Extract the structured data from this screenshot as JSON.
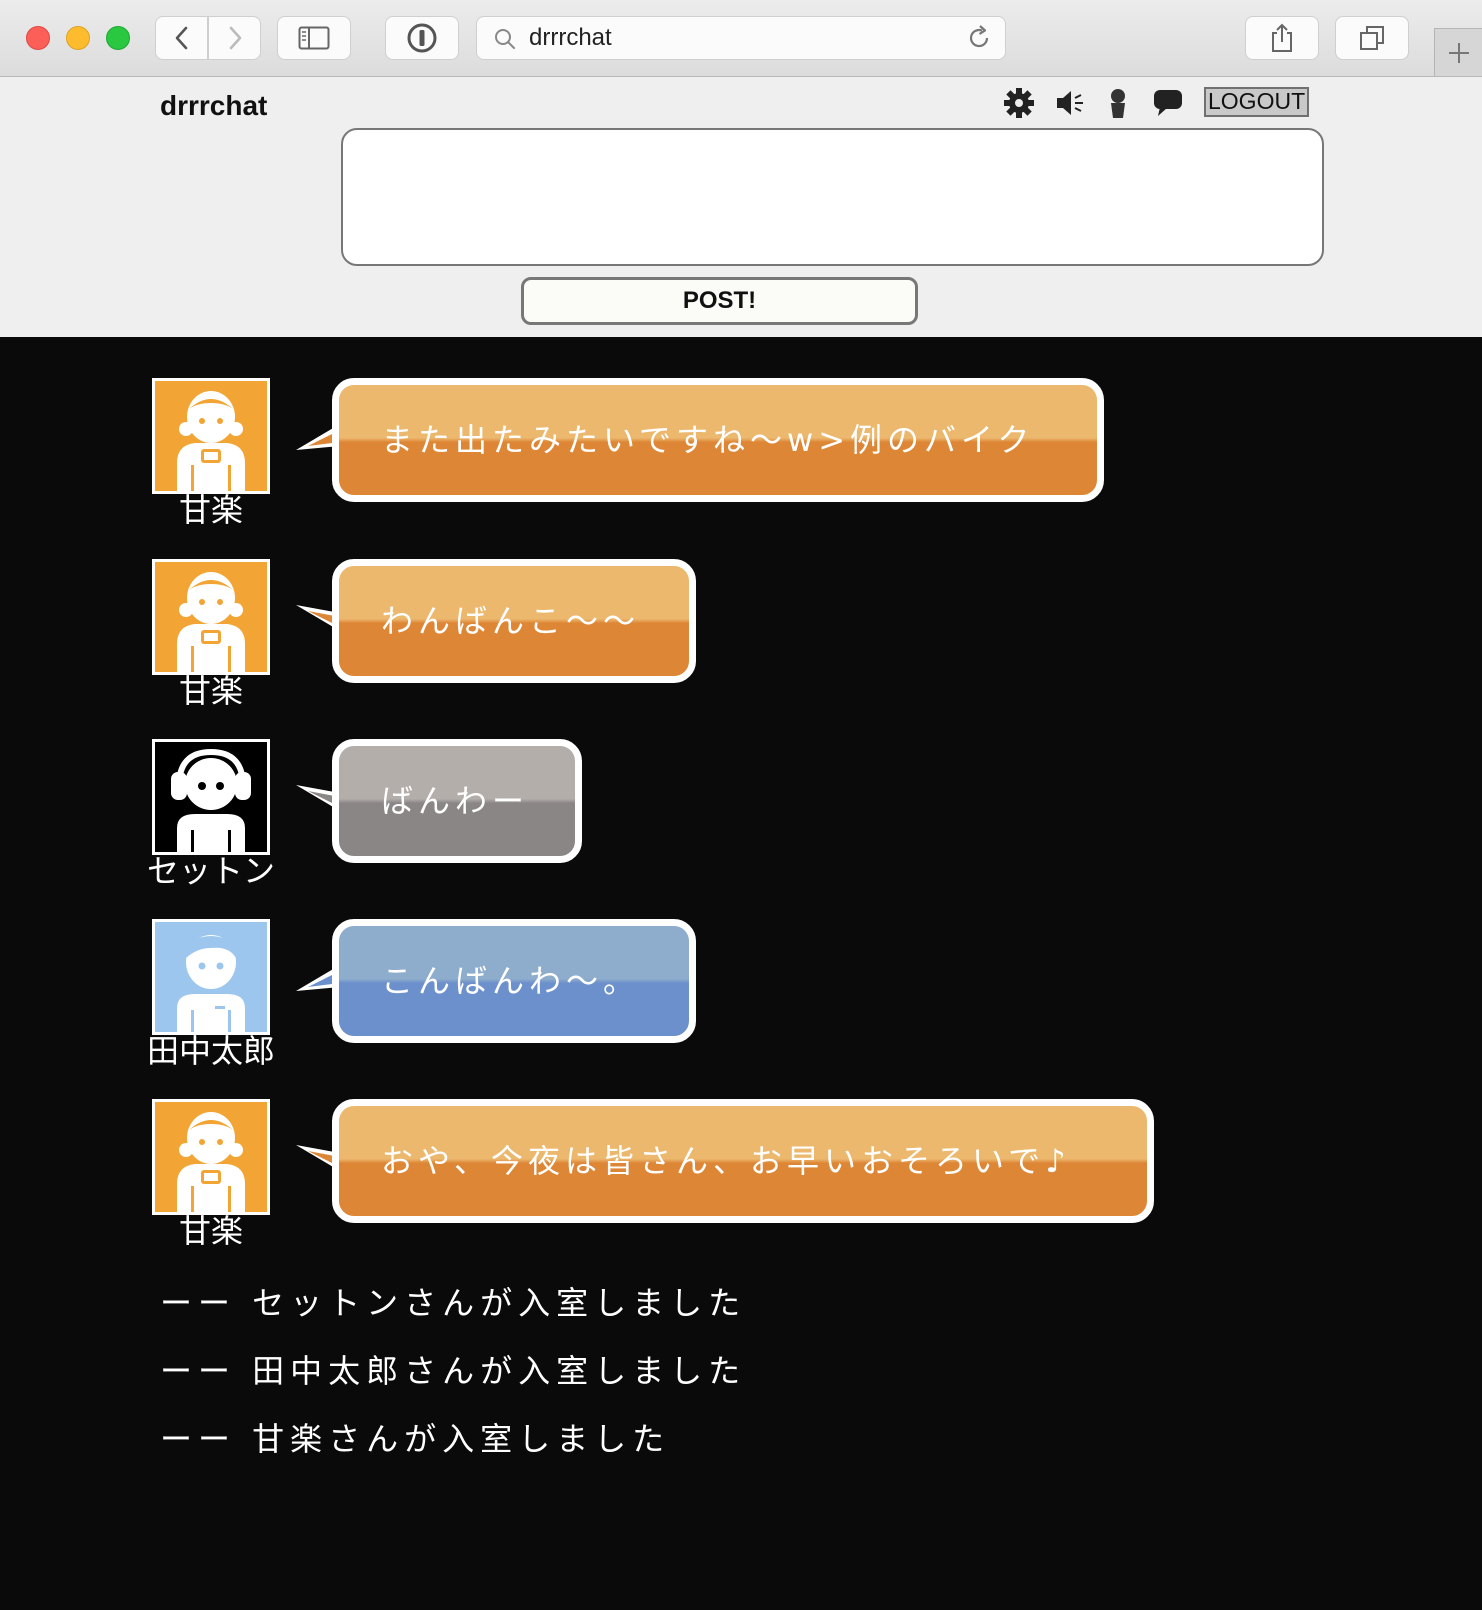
{
  "browser": {
    "address_text": "drrrchat"
  },
  "header": {
    "site_title": "drrrchat",
    "logout_label": "LOGOUT",
    "post_label": "POST!",
    "message_value": ""
  },
  "messages": [
    {
      "user": "甘楽",
      "text": "また出たみたいですね～w>例のバイク",
      "color": "orange",
      "avatar": "girl-avatar-orange"
    },
    {
      "user": "甘楽",
      "text": "わんばんこ～～",
      "color": "orange",
      "avatar": "girl-avatar-orange"
    },
    {
      "user": "セットン",
      "text": "ばんわー",
      "color": "gray",
      "avatar": "headphone-avatar-black"
    },
    {
      "user": "田中太郎",
      "text": "こんばんわ～。",
      "color": "blue",
      "avatar": "boy-avatar-blue"
    },
    {
      "user": "甘楽",
      "text": "おや、今夜は皆さん、お早いおそろいで♪",
      "color": "orange",
      "avatar": "girl-avatar-orange"
    }
  ],
  "system_messages": [
    "ーー セットンさんが入室しました",
    "ーー 田中太郎さんが入室しました",
    "ーー 甘楽さんが入室しました"
  ],
  "colors": {
    "orange_top": "#ecb86e",
    "orange_bottom": "#dd8635",
    "gray_top": "#b3aeaa",
    "gray_bottom": "#8b8686",
    "blue_top": "#8eaccc",
    "blue_bottom": "#6b90cb",
    "chat_background": "#0a0a0a"
  }
}
